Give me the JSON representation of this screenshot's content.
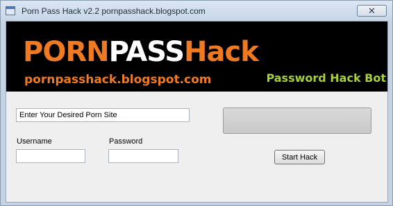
{
  "window": {
    "title": "Porn Pass Hack v2.2 pornpasshack.blogspot.com",
    "close_glyph": "✕"
  },
  "banner": {
    "logo_part1": "PORN",
    "logo_part2": "PASS",
    "logo_part3": "Hack",
    "url": "pornpasshack.blogspot.com",
    "tagline": "Password Hack Bot"
  },
  "form": {
    "site_value": "Enter Your Desired Porn Site",
    "username_label": "Username",
    "username_value": "",
    "password_label": "Password",
    "password_value": "",
    "start_label": "Start Hack",
    "progress": 0
  },
  "colors": {
    "accent_orange": "#ef7a22",
    "accent_green": "#a6cf3c",
    "banner_bg": "#000000"
  },
  "icons": [
    "app-icon",
    "close-icon"
  ]
}
